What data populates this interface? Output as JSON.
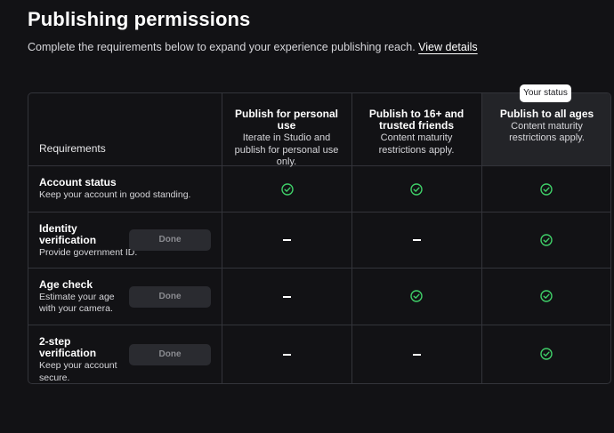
{
  "page": {
    "title": "Publishing permissions",
    "subtitle": "Complete the requirements below to expand your experience publishing reach.",
    "details_link": "View details"
  },
  "status_badge": "Your status",
  "table": {
    "requirements_header": "Requirements",
    "columns": [
      {
        "title": "Publish for personal use",
        "desc": "Iterate in Studio and publish for personal use only."
      },
      {
        "title": "Publish to 16+ and trusted friends",
        "desc": "Content maturity restrictions apply."
      },
      {
        "title": "Publish to all ages",
        "desc": "Content maturity restrictions apply."
      }
    ],
    "rows": [
      {
        "title": "Account status",
        "desc": "Keep your account in good standing.",
        "button": "",
        "cells": [
          "check",
          "check",
          "check"
        ]
      },
      {
        "title": "Identity verification",
        "desc": "Provide government ID.",
        "button": "Done",
        "cells": [
          "dash",
          "dash",
          "check"
        ]
      },
      {
        "title": "Age check",
        "desc": "Estimate your age with your camera.",
        "button": "Done",
        "cells": [
          "dash",
          "check",
          "check"
        ]
      },
      {
        "title": "2-step verification",
        "desc": "Keep your account secure.",
        "button": "Done",
        "cells": [
          "dash",
          "dash",
          "check"
        ]
      }
    ]
  },
  "colors": {
    "background": "#121215",
    "highlight_column": "#232428",
    "border": "#33343a",
    "check_green": "#3fce68",
    "done_button_bg": "#2a2b30"
  },
  "icons": {
    "check": "check-circle-icon",
    "dash": "dash-icon"
  }
}
